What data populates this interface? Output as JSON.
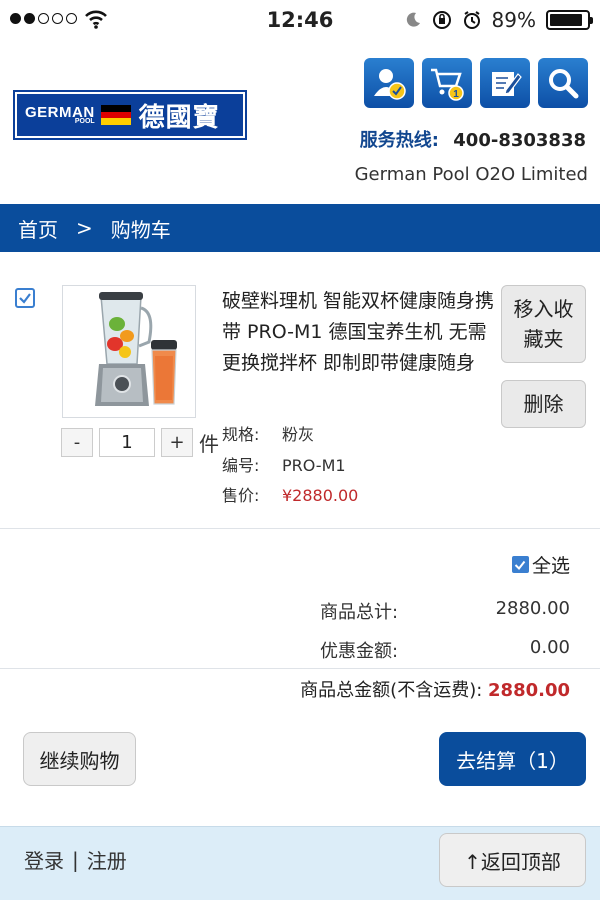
{
  "status_bar": {
    "time": "12:46",
    "battery_percent": "89%",
    "battery_level": 0.89,
    "signal_bars": 2
  },
  "header": {
    "logo": {
      "en_main": "GERMAN",
      "en_sub": "POOL",
      "cn": "德國寶"
    },
    "icons": [
      "user-check-icon",
      "cart-icon",
      "edit-icon",
      "search-icon"
    ],
    "hotline_label": "服务热线:",
    "hotline_number": "400-8303838",
    "company": "German Pool O2O Limited"
  },
  "nav": {
    "home": "首页",
    "separator": ">",
    "current": "购物车"
  },
  "cart_item": {
    "checked": true,
    "name": "破壁料理机 智能双杯健康随身携带 PRO-M1 德国宝养生机 无需更换搅拌杯 即制即带健康随身",
    "quantity": "1",
    "qty_minus": "-",
    "qty_plus": "+",
    "unit": "件",
    "spec_label": "规格:",
    "spec_value": "粉灰",
    "code_label": "编号:",
    "code_value": "PRO-M1",
    "price_label": "售价:",
    "price_value": "¥2880.00",
    "move_to_fav": "移入收藏夹",
    "delete": "删除"
  },
  "summary": {
    "select_all": "全选",
    "subtotal_label": "商品总计:",
    "subtotal_value": "2880.00",
    "discount_label": "优惠金额:",
    "discount_value": "0.00",
    "total_label": "商品总金额(不含运费):",
    "total_value": "2880.00"
  },
  "actions": {
    "continue": "继续购物",
    "checkout": "去结算（1）"
  },
  "footer": {
    "login": "登录",
    "divider": "|",
    "register": "注册",
    "back_top": "↑返回顶部"
  },
  "colors": {
    "brand_blue": "#0a4d9c",
    "price_red": "#c0292b",
    "footer_bg": "#dcedf8"
  }
}
